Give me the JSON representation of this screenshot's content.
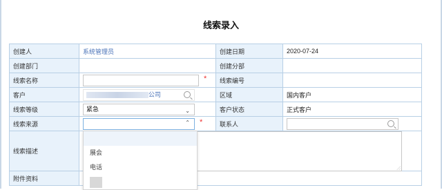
{
  "page": {
    "title": "线索录入"
  },
  "rows": {
    "creator": {
      "label": "创建人",
      "value": "系统管理员"
    },
    "create_date": {
      "label": "创建日期",
      "value": "2020-07-24"
    },
    "dept": {
      "label": "创建部门",
      "value": ""
    },
    "branch": {
      "label": "创建分部",
      "value": ""
    },
    "lead_name": {
      "label": "线索名称",
      "value": "",
      "required": "*"
    },
    "lead_no": {
      "label": "线索编号",
      "value": ""
    },
    "customer": {
      "label": "客户",
      "value_tail": "公司",
      "icon": "search-icon"
    },
    "region": {
      "label": "区域",
      "value": "国内客户"
    },
    "lead_level": {
      "label": "线索等级",
      "value": "紧急"
    },
    "customer_status": {
      "label": "客户状态",
      "value": "正式客户"
    },
    "lead_source": {
      "label": "线索来源",
      "value": "",
      "required": "*"
    },
    "contact": {
      "label": "联系人",
      "value": "",
      "icon": "search-icon"
    },
    "lead_desc": {
      "label": "线索描述",
      "required": "*"
    },
    "attachment": {
      "label": "附件资料"
    }
  },
  "source_dropdown": {
    "options": [
      "",
      "展会",
      "电话"
    ]
  }
}
